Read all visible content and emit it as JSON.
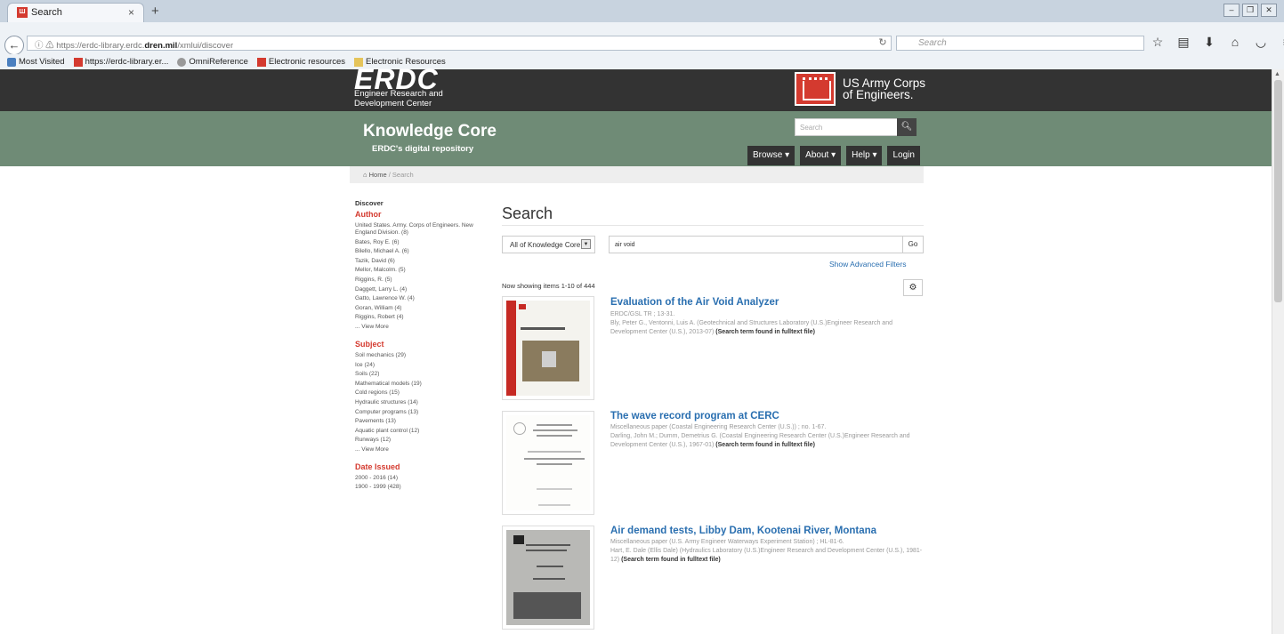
{
  "browser": {
    "tab_title": "Search",
    "tab_close": "×",
    "new_tab": "+",
    "url_prefix": "https://erdc-library.erdc.",
    "url_domain": "dren.mil",
    "url_suffix": "/xmlui/discover",
    "search_placeholder": "Search",
    "bookmarks": [
      "Most Visited",
      "https://erdc-library.er...",
      "OmniReference",
      "Electronic resources",
      "Electronic Resources"
    ]
  },
  "header": {
    "logo": "ERDC",
    "logo_sub1": "Engineer Research and",
    "logo_sub2": "Development Center",
    "usace_line1": "US Army Corps",
    "usace_line2": "of Engineers.",
    "site_title": "Knowledge Core",
    "site_subtitle": "ERDC's digital repository",
    "search_placeholder": "Search",
    "nav": [
      "Browse ▾",
      "About ▾",
      "Help ▾",
      "Login"
    ]
  },
  "breadcrumb": {
    "home": "Home",
    "sep": "/",
    "current": "Search"
  },
  "sidebar": {
    "discover": "Discover",
    "sections": [
      {
        "title": "Author",
        "items": [
          "United States. Army. Corps of Engineers. New England Division. (8)",
          "Bates, Roy E. (6)",
          "Bilello, Michael A. (6)",
          "Tazik, David (6)",
          "Mellor, Malcolm. (5)",
          "Riggins, R. (5)",
          "Daggett, Larry L. (4)",
          "Gatto, Lawrence W. (4)",
          "Goran, William (4)",
          "Riggins, Robert (4)",
          "... View More"
        ]
      },
      {
        "title": "Subject",
        "items": [
          "Soil mechanics (29)",
          "Ice (24)",
          "Soils (22)",
          "Mathematical models (19)",
          "Cold regions (15)",
          "Hydraulic structures (14)",
          "Computer programs (13)",
          "Pavements (13)",
          "Aquatic plant control (12)",
          "Runways (12)",
          "... View More"
        ]
      },
      {
        "title": "Date Issued",
        "items": [
          "2000 - 2016 (14)",
          "1900 - 1999 (428)"
        ]
      }
    ]
  },
  "main": {
    "heading": "Search",
    "scope": "All of Knowledge Core",
    "query": "air void",
    "go": "Go",
    "advanced": "Show Advanced Filters",
    "showing": "Now showing items 1-10 of 444",
    "found_note": "(Search term found in fulltext file)",
    "results": [
      {
        "title": "Evaluation of the Air Void Analyzer",
        "series": "ERDC/GSL TR ; 13-31.",
        "authors": "Bly, Peter G., Ventonni, Luis A. (Geotechnical and Structures Laboratory (U.S.)Engineer Research and Development Center (U.S.), 2013-07)"
      },
      {
        "title": "The wave record program at CERC",
        "series": "Miscellaneous paper (Coastal Engineering Research Center (U.S.)) ; no. 1-67.",
        "authors": "Darling, John M.; Dumm, Demetrius G. (Coastal Engineering Research Center (U.S.)Engineer Research and Development Center (U.S.), 1967-01)"
      },
      {
        "title": "Air demand tests, Libby Dam, Kootenai River, Montana",
        "series": "Miscellaneous paper (U.S. Army Engineer Waterways Experiment Station) ; HL-81-6.",
        "authors": "Hart, E. Dale (Ellis Dale) (Hydraulics Laboratory (U.S.)Engineer Research and Development Center (U.S.), 1981-12)"
      }
    ]
  }
}
